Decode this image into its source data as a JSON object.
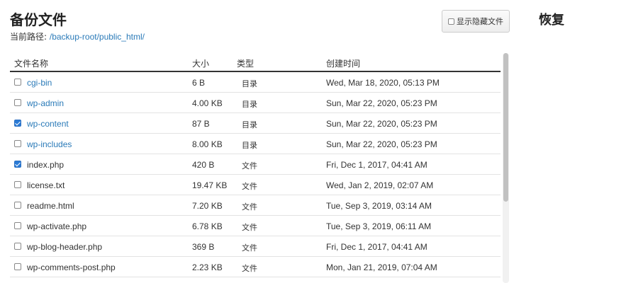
{
  "header": {
    "title": "备份文件",
    "path_label": "当前路径:",
    "path_value": "/backup-root/public_html/",
    "show_hidden_label": "显示隐藏文件",
    "restore_title": "恢复"
  },
  "table": {
    "columns": {
      "name": "文件名称",
      "size": "大小",
      "type": "类型",
      "created": "创建时间"
    },
    "rows": [
      {
        "name": "cgi-bin",
        "size": "6 B",
        "type": "目录",
        "created": "Wed, Mar 18, 2020, 05:13 PM",
        "checked": false,
        "is_dir": true
      },
      {
        "name": "wp-admin",
        "size": "4.00 KB",
        "type": "目录",
        "created": "Sun, Mar 22, 2020, 05:23 PM",
        "checked": false,
        "is_dir": true
      },
      {
        "name": "wp-content",
        "size": "87 B",
        "type": "目录",
        "created": "Sun, Mar 22, 2020, 05:23 PM",
        "checked": true,
        "is_dir": true
      },
      {
        "name": "wp-includes",
        "size": "8.00 KB",
        "type": "目录",
        "created": "Sun, Mar 22, 2020, 05:23 PM",
        "checked": false,
        "is_dir": true
      },
      {
        "name": "index.php",
        "size": "420 B",
        "type": "文件",
        "created": "Fri, Dec 1, 2017, 04:41 AM",
        "checked": true,
        "is_dir": false
      },
      {
        "name": "license.txt",
        "size": "19.47 KB",
        "type": "文件",
        "created": "Wed, Jan 2, 2019, 02:07 AM",
        "checked": false,
        "is_dir": false
      },
      {
        "name": "readme.html",
        "size": "7.20 KB",
        "type": "文件",
        "created": "Tue, Sep 3, 2019, 03:14 AM",
        "checked": false,
        "is_dir": false
      },
      {
        "name": "wp-activate.php",
        "size": "6.78 KB",
        "type": "文件",
        "created": "Tue, Sep 3, 2019, 06:11 AM",
        "checked": false,
        "is_dir": false
      },
      {
        "name": "wp-blog-header.php",
        "size": "369 B",
        "type": "文件",
        "created": "Fri, Dec 1, 2017, 04:41 AM",
        "checked": false,
        "is_dir": false
      },
      {
        "name": "wp-comments-post.php",
        "size": "2.23 KB",
        "type": "文件",
        "created": "Mon, Jan 21, 2019, 07:04 AM",
        "checked": false,
        "is_dir": false
      }
    ]
  },
  "colors": {
    "link": "#2a7ab8",
    "checkbox_checked": "#2b7bd6"
  }
}
